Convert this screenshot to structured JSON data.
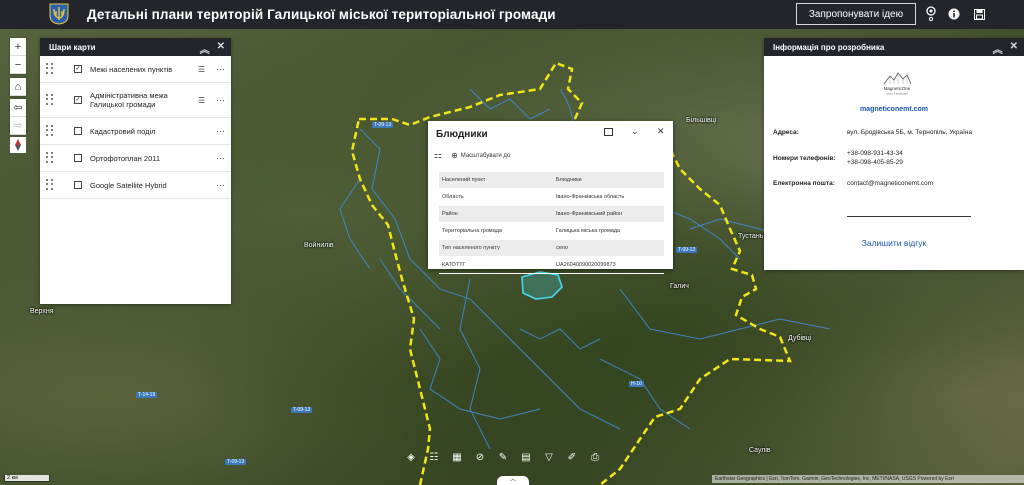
{
  "header": {
    "title": "Детальні плани територій Галицької міської територіальної громади",
    "idea_button": "Запропонувати ідею",
    "icons": [
      "logo-trident-icon",
      "view-icon",
      "info-icon",
      "save-icon"
    ]
  },
  "map": {
    "places": [
      "Більшівці",
      "Войнилів",
      "Верхня",
      "Тустань",
      "Галич",
      "Дубівці",
      "Саулів",
      "Блюдники"
    ],
    "roads": [
      "T-09-13",
      "T-09-13",
      "H-10",
      "T-14-19",
      "T-09-13",
      "T-09-13"
    ],
    "scale": "2 км",
    "attribution": "Earthstar Geographics | Esri, TomTom, Garmin, GeoTechnologies, Inc, METI/NASA, USGS   Powered by Esri"
  },
  "layers_panel": {
    "title": "Шари карти",
    "layers": [
      {
        "label": "Межі населених пунктів",
        "checked": "✓",
        "legend": "☰"
      },
      {
        "label": "Адміністративна межа Галицької громади",
        "checked": "✓",
        "legend": "☰"
      },
      {
        "label": "Кадастровий поділ",
        "checked": "",
        "legend": ""
      },
      {
        "label": "Ортофотоплан 2011",
        "checked": "",
        "legend": ""
      },
      {
        "label": "Google Satellite Hybrid",
        "checked": "",
        "legend": ""
      }
    ]
  },
  "popup": {
    "title": "Блюдники",
    "zoom_to": "Масштабувати до",
    "rows": [
      {
        "field": "Населений пункт",
        "value": "Блюдники"
      },
      {
        "field": "Область",
        "value": "Івано-Франківська область"
      },
      {
        "field": "Район",
        "value": "Івано-Франківський район"
      },
      {
        "field": "Територіальна громада",
        "value": "Галицька міська громада"
      },
      {
        "field": "Тип населеного пункту",
        "value": "село"
      },
      {
        "field": "КАТОТТГ",
        "value": "UA26040090020099873"
      }
    ]
  },
  "info_panel": {
    "title": "Інформація про розробника",
    "brand": "MagneticOne",
    "brand_sub": "urban & landscape",
    "website": "magneticonemt.com",
    "address_label": "Адреса:",
    "address": "вул. Бродівська 5Б, м. Тернопіль, Україна",
    "phones_label": "Номери телефонів:",
    "phone1": "+38-098-931-43-34",
    "phone2": "+38-098-405-85-29",
    "email_label": "Електронна пошта:",
    "email": "contact@magneticonemt.com",
    "feedback": "Залишити відгук"
  },
  "colors": {
    "header_bg": "#23252a",
    "boundary_yellow": "#f2e61a",
    "settlement_blue": "#3f8fe0",
    "selected_cyan": "#47d7f0",
    "link_blue": "#1a56b0"
  }
}
